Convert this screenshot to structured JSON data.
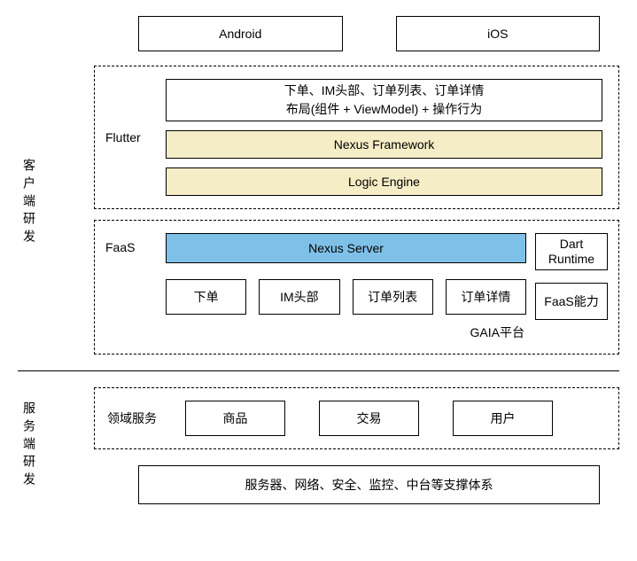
{
  "section_labels": {
    "client": "客户端研发",
    "server": "服务端研发"
  },
  "platforms": {
    "android": "Android",
    "ios": "iOS"
  },
  "flutter": {
    "label": "Flutter",
    "header_line1": "下单、IM头部、订单列表、订单详情",
    "header_line2": "布局(组件 + ViewModel) + 操作行为",
    "nexus_framework": "Nexus Framework",
    "logic_engine": "Logic Engine"
  },
  "faas": {
    "label": "FaaS",
    "nexus_server": "Nexus Server",
    "dart_runtime": "Dart Runtime",
    "faas_capability": "FaaS能力",
    "gaia": "GAIA平台",
    "modules": {
      "order": "下单",
      "im_header": "IM头部",
      "order_list": "订单列表",
      "order_detail": "订单详情"
    }
  },
  "domain": {
    "label": "领域服务",
    "product": "商品",
    "trade": "交易",
    "user": "用户"
  },
  "infra": "服务器、网络、安全、监控、中台等支撑体系"
}
